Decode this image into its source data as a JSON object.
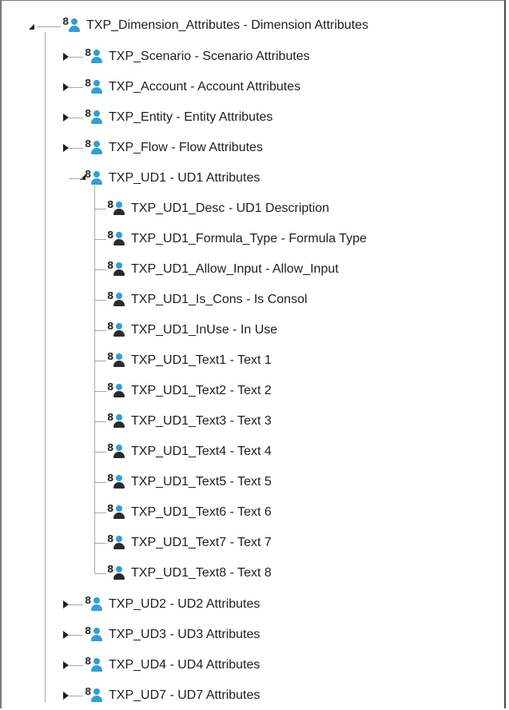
{
  "tree": {
    "root": {
      "label": "TXP_Dimension_Attributes - Dimension Attributes",
      "expanded": true,
      "icon": "user-group-icon"
    },
    "groups_top": [
      {
        "label": "TXP_Scenario - Scenario Attributes",
        "expanded": false
      },
      {
        "label": "TXP_Account - Account Attributes",
        "expanded": false
      },
      {
        "label": "TXP_Entity - Entity Attributes",
        "expanded": false
      },
      {
        "label": "TXP_Flow - Flow Attributes",
        "expanded": false
      }
    ],
    "ud1": {
      "label": "TXP_UD1 - UD1 Attributes",
      "expanded": true,
      "children": [
        {
          "label": "TXP_UD1_Desc - UD1 Description"
        },
        {
          "label": "TXP_UD1_Formula_Type - Formula Type"
        },
        {
          "label": "TXP_UD1_Allow_Input - Allow_Input"
        },
        {
          "label": "TXP_UD1_Is_Cons - Is Consol"
        },
        {
          "label": "TXP_UD1_InUse - In Use"
        },
        {
          "label": "TXP_UD1_Text1 - Text 1"
        },
        {
          "label": "TXP_UD1_Text2 - Text 2"
        },
        {
          "label": "TXP_UD1_Text3 - Text 3"
        },
        {
          "label": "TXP_UD1_Text4 - Text 4"
        },
        {
          "label": "TXP_UD1_Text5 - Text 5"
        },
        {
          "label": "TXP_UD1_Text6 - Text 6"
        },
        {
          "label": "TXP_UD1_Text7 - Text 7"
        },
        {
          "label": "TXP_UD1_Text8 - Text 8"
        }
      ]
    },
    "groups_bottom": [
      {
        "label": "TXP_UD2 - UD2 Attributes",
        "expanded": false
      },
      {
        "label": "TXP_UD3 - UD3 Attributes",
        "expanded": false
      },
      {
        "label": "TXP_UD4 - UD4 Attributes",
        "expanded": false
      },
      {
        "label": "TXP_UD7 - UD7 Attributes",
        "expanded": false
      }
    ]
  },
  "colors": {
    "icon_accent": "#2f9fd8",
    "connector_line": "#a8a8a8",
    "text": "#1e1e1e"
  }
}
